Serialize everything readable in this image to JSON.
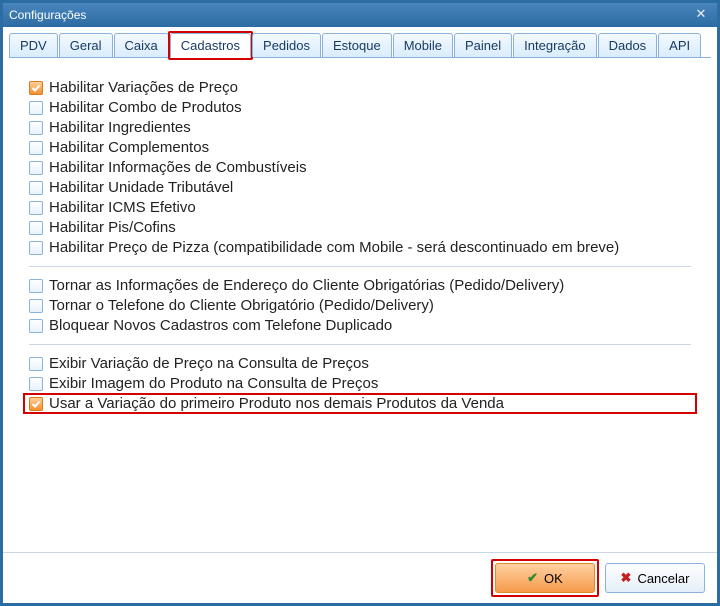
{
  "window": {
    "title": "Configurações"
  },
  "tabs": [
    {
      "label": "PDV"
    },
    {
      "label": "Geral"
    },
    {
      "label": "Caixa"
    },
    {
      "label": "Cadastros",
      "active": true,
      "highlight": true
    },
    {
      "label": "Pedidos"
    },
    {
      "label": "Estoque"
    },
    {
      "label": "Mobile"
    },
    {
      "label": "Painel"
    },
    {
      "label": "Integração"
    },
    {
      "label": "Dados"
    },
    {
      "label": "API"
    }
  ],
  "groups": [
    [
      {
        "label": "Habilitar Variações de Preço",
        "checked": true
      },
      {
        "label": "Habilitar Combo de Produtos",
        "checked": false
      },
      {
        "label": "Habilitar Ingredientes",
        "checked": false
      },
      {
        "label": "Habilitar Complementos",
        "checked": false
      },
      {
        "label": "Habilitar Informações de Combustíveis",
        "checked": false
      },
      {
        "label": "Habilitar Unidade Tributável",
        "checked": false
      },
      {
        "label": "Habilitar ICMS Efetivo",
        "checked": false
      },
      {
        "label": "Habilitar Pis/Cofins",
        "checked": false
      },
      {
        "label": "Habilitar Preço de Pizza (compatibilidade com Mobile - será descontinuado em breve)",
        "checked": false
      }
    ],
    [
      {
        "label": "Tornar as Informações de Endereço do Cliente Obrigatórias (Pedido/Delivery)",
        "checked": false
      },
      {
        "label": "Tornar o Telefone do Cliente Obrigatório (Pedido/Delivery)",
        "checked": false
      },
      {
        "label": "Bloquear Novos Cadastros com Telefone Duplicado",
        "checked": false
      }
    ],
    [
      {
        "label": "Exibir Variação de Preço na Consulta de Preços",
        "checked": false
      },
      {
        "label": "Exibir Imagem do Produto na Consulta de Preços",
        "checked": false
      },
      {
        "label": "Usar a Variação do primeiro Produto nos demais Produtos da Venda",
        "checked": true,
        "highlight": true
      }
    ]
  ],
  "footer": {
    "ok": "OK",
    "cancel": "Cancelar"
  }
}
